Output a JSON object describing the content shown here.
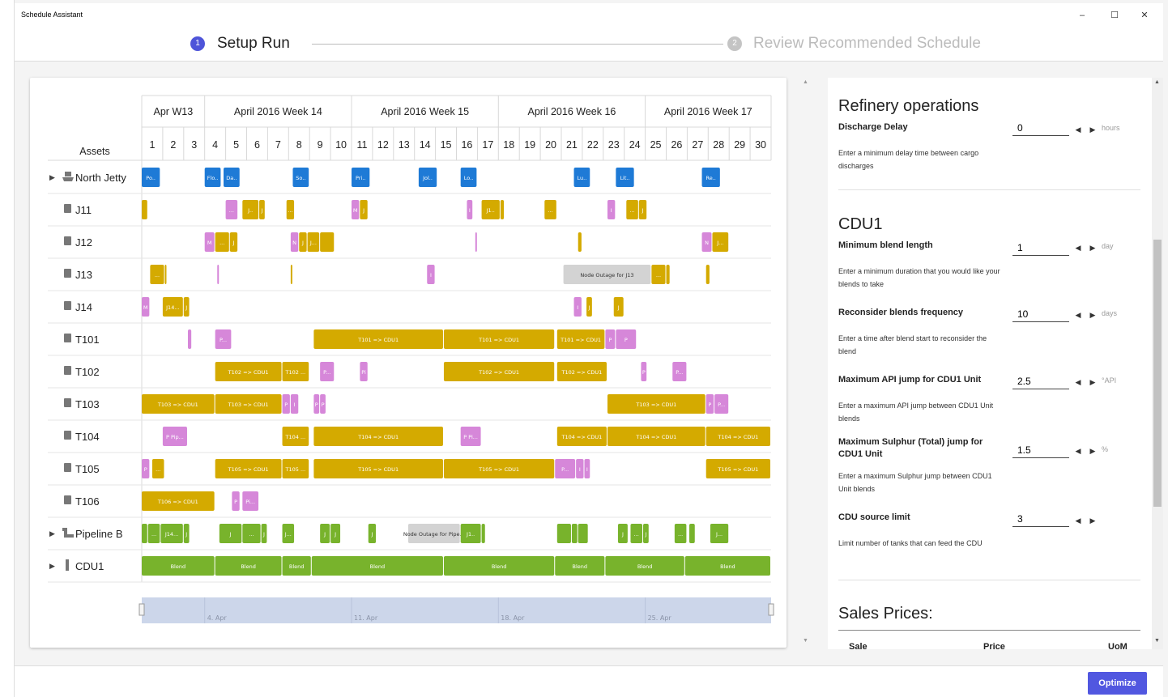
{
  "window": {
    "title": "Schedule Assistant",
    "minimize": "–",
    "maximize": "☐",
    "close": "✕"
  },
  "stepper": {
    "steps": [
      {
        "num": "1",
        "label": "Setup Run",
        "active": true
      },
      {
        "num": "2",
        "label": "Review Recommended Schedule",
        "active": false
      }
    ]
  },
  "gantt": {
    "assets_header": "Assets",
    "weeks": [
      {
        "label": "Apr W13",
        "start": 1,
        "end": 3
      },
      {
        "label": "April 2016 Week 14",
        "start": 4,
        "end": 10
      },
      {
        "label": "April 2016 Week 15",
        "start": 11,
        "end": 17
      },
      {
        "label": "April 2016 Week 16",
        "start": 18,
        "end": 24
      },
      {
        "label": "April 2016 Week 17",
        "start": 25,
        "end": 30
      }
    ],
    "days": [
      "1",
      "2",
      "3",
      "4",
      "5",
      "6",
      "7",
      "8",
      "9",
      "10",
      "11",
      "12",
      "13",
      "14",
      "15",
      "16",
      "17",
      "18",
      "19",
      "20",
      "21",
      "22",
      "23",
      "24",
      "25",
      "26",
      "27",
      "28",
      "29",
      "30"
    ],
    "rows": [
      {
        "label": "North Jetty",
        "icon": "ship-icon",
        "expand": true
      },
      {
        "label": "J11",
        "icon": "tank-icon"
      },
      {
        "label": "J12",
        "icon": "tank-icon"
      },
      {
        "label": "J13",
        "icon": "tank-icon"
      },
      {
        "label": "J14",
        "icon": "tank-icon"
      },
      {
        "label": "T101",
        "icon": "tank-icon"
      },
      {
        "label": "T102",
        "icon": "tank-icon"
      },
      {
        "label": "T103",
        "icon": "tank-icon"
      },
      {
        "label": "T104",
        "icon": "tank-icon"
      },
      {
        "label": "T105",
        "icon": "tank-icon"
      },
      {
        "label": "T106",
        "icon": "tank-icon"
      },
      {
        "label": "Pipeline B",
        "icon": "pipeline-icon",
        "expand": true
      },
      {
        "label": "CDU1",
        "icon": "cdu-icon",
        "expand": true
      }
    ],
    "bars": [
      [
        0,
        1,
        1.9,
        "b",
        "Po.."
      ],
      [
        0,
        4,
        4.8,
        "b",
        "Flo.."
      ],
      [
        0,
        4.9,
        5.7,
        "b",
        "Da.."
      ],
      [
        0,
        8.2,
        9,
        "b",
        "So.."
      ],
      [
        0,
        11,
        11.9,
        "b",
        "Pri.."
      ],
      [
        0,
        14.2,
        15.1,
        "b",
        "Jol.."
      ],
      [
        0,
        16.2,
        17,
        "b",
        "Lo.."
      ],
      [
        0,
        21.6,
        22.4,
        "b",
        "Lu.."
      ],
      [
        0,
        23.6,
        24.5,
        "b",
        "Lit.."
      ],
      [
        0,
        27.7,
        28.6,
        "b",
        "Re.."
      ],
      [
        1,
        1,
        1.3,
        "y",
        ""
      ],
      [
        1,
        5,
        5.6,
        "p",
        "..."
      ],
      [
        1,
        5.8,
        6.6,
        "y",
        "J.."
      ],
      [
        1,
        6.6,
        6.9,
        "y",
        "J"
      ],
      [
        1,
        7.9,
        8.3,
        "y",
        "..."
      ],
      [
        1,
        11,
        11.4,
        "p",
        "M"
      ],
      [
        1,
        11.4,
        11.8,
        "y",
        "J"
      ],
      [
        1,
        16.5,
        16.8,
        "p",
        "I"
      ],
      [
        1,
        17.2,
        18.1,
        "y",
        "J1.."
      ],
      [
        1,
        18.1,
        18.3,
        "y",
        "J"
      ],
      [
        1,
        20.2,
        20.8,
        "y",
        "..."
      ],
      [
        1,
        23.2,
        23.6,
        "p",
        "I"
      ],
      [
        1,
        24.1,
        24.7,
        "y",
        "..."
      ],
      [
        1,
        24.7,
        25.1,
        "y",
        "J"
      ],
      [
        2,
        4,
        4.5,
        "p",
        "M"
      ],
      [
        2,
        4.5,
        5.2,
        "y",
        "..."
      ],
      [
        2,
        5.2,
        5.6,
        "y",
        "J"
      ],
      [
        2,
        8.1,
        8.5,
        "p",
        "N"
      ],
      [
        2,
        8.5,
        8.9,
        "y",
        "J"
      ],
      [
        2,
        8.9,
        9.5,
        "y",
        "J..."
      ],
      [
        2,
        9.5,
        10.2,
        "y",
        ""
      ],
      [
        2,
        16.9,
        17,
        "p",
        "N"
      ],
      [
        2,
        21.8,
        22,
        "y",
        ""
      ],
      [
        2,
        27.7,
        28.2,
        "p",
        "N"
      ],
      [
        2,
        28.2,
        29,
        "y",
        "J..."
      ],
      [
        3,
        1.4,
        2.1,
        "y",
        "..."
      ],
      [
        3,
        2.1,
        2.2,
        "y",
        "J"
      ],
      [
        3,
        4.6,
        4.62,
        "p",
        ""
      ],
      [
        3,
        8.1,
        8.16,
        "y",
        "J"
      ],
      [
        3,
        14.6,
        15,
        "p",
        "I"
      ],
      [
        3,
        21.1,
        25.3,
        "g",
        "Node Outage for J13"
      ],
      [
        3,
        25.3,
        26,
        "y",
        "..."
      ],
      [
        3,
        26,
        26.2,
        "y",
        "J"
      ],
      [
        3,
        27.9,
        28.1,
        "y",
        "J"
      ],
      [
        4,
        1,
        1.4,
        "p",
        "M"
      ],
      [
        4,
        2,
        3,
        "y",
        "J14..."
      ],
      [
        4,
        3,
        3.3,
        "y",
        "J"
      ],
      [
        4,
        21.6,
        22,
        "p",
        "I"
      ],
      [
        4,
        22.2,
        22.5,
        "y",
        "J"
      ],
      [
        4,
        23.5,
        24,
        "y",
        "J"
      ],
      [
        5,
        3.2,
        3.4,
        "p",
        "P"
      ],
      [
        5,
        4.5,
        5.3,
        "p",
        "P..."
      ],
      [
        5,
        9.2,
        15.4,
        "y",
        "T101 => CDU1"
      ],
      [
        5,
        15.4,
        20.7,
        "y",
        "T101 => CDU1"
      ],
      [
        5,
        20.8,
        23.1,
        "y",
        "T101 => CDU1"
      ],
      [
        5,
        23.1,
        23.6,
        "p",
        "P"
      ],
      [
        5,
        23.6,
        24.6,
        "p",
        "P"
      ],
      [
        6,
        4.5,
        7.7,
        "y",
        "T102 => CDU1"
      ],
      [
        6,
        7.7,
        9,
        "y",
        "T102 ..."
      ],
      [
        6,
        9.5,
        10.2,
        "p",
        "P..."
      ],
      [
        6,
        11.4,
        11.8,
        "p",
        "Pi"
      ],
      [
        6,
        15.4,
        20.7,
        "y",
        "T102 => CDU1"
      ],
      [
        6,
        20.8,
        23.2,
        "y",
        "T102 => CDU1"
      ],
      [
        6,
        24.8,
        25.1,
        "p",
        "P"
      ],
      [
        6,
        26.3,
        27,
        "p",
        "P..."
      ],
      [
        7,
        1,
        4.5,
        "y",
        "T103 => CDU1"
      ],
      [
        7,
        4.5,
        7.7,
        "y",
        "T103 => CDU1"
      ],
      [
        7,
        7.7,
        8.1,
        "p",
        "P"
      ],
      [
        7,
        8.1,
        8.5,
        "p",
        "I"
      ],
      [
        7,
        9.2,
        9.5,
        "p",
        "P"
      ],
      [
        7,
        9.5,
        9.8,
        "p",
        "P"
      ],
      [
        7,
        23.2,
        27.9,
        "y",
        "T103 => CDU1"
      ],
      [
        7,
        27.9,
        28.3,
        "p",
        "P"
      ],
      [
        7,
        28.3,
        29,
        "p",
        "P..."
      ],
      [
        8,
        2,
        3.2,
        "p",
        "P Pip..."
      ],
      [
        8,
        7.7,
        9,
        "y",
        "T104 ..."
      ],
      [
        8,
        9.2,
        15.4,
        "y",
        "T104 => CDU1"
      ],
      [
        8,
        16.2,
        17.2,
        "p",
        "P Pi..."
      ],
      [
        8,
        20.8,
        23.2,
        "y",
        "T104 => CDU1"
      ],
      [
        8,
        23.2,
        27.9,
        "y",
        "T104 => CDU1"
      ],
      [
        8,
        27.9,
        31,
        "y",
        "T104 => CDU1"
      ],
      [
        9,
        1,
        1.4,
        "p",
        "P"
      ],
      [
        9,
        1.5,
        2.1,
        "y",
        "..."
      ],
      [
        9,
        4.5,
        7.7,
        "y",
        "T105 => CDU1"
      ],
      [
        9,
        7.7,
        9,
        "y",
        "T105 ..."
      ],
      [
        9,
        9.2,
        15.4,
        "y",
        "T105 => CDU1"
      ],
      [
        9,
        15.4,
        20.7,
        "y",
        "T105 => CDU1"
      ],
      [
        9,
        20.7,
        21.7,
        "p",
        "P..."
      ],
      [
        9,
        21.7,
        22.1,
        "p",
        "I"
      ],
      [
        9,
        22.1,
        22.4,
        "p",
        "I"
      ],
      [
        9,
        27.9,
        31,
        "y",
        "T105 => CDU1"
      ],
      [
        10,
        1,
        4.5,
        "y",
        "T106 => CDU1"
      ],
      [
        10,
        5.3,
        5.7,
        "p",
        "P"
      ],
      [
        10,
        5.8,
        6.6,
        "p",
        "Pi..."
      ],
      [
        11,
        1,
        1.3,
        "gr",
        ""
      ],
      [
        11,
        1.3,
        1.9,
        "gr",
        "..."
      ],
      [
        11,
        1.9,
        3,
        "gr",
        "J14..."
      ],
      [
        11,
        3,
        3.3,
        "gr",
        "J"
      ],
      [
        11,
        4.7,
        5.8,
        "gr",
        "J"
      ],
      [
        11,
        5.8,
        6.7,
        "gr",
        "..."
      ],
      [
        11,
        6.7,
        7,
        "gr",
        "J"
      ],
      [
        11,
        7.7,
        8.3,
        "gr",
        "J..."
      ],
      [
        11,
        9.5,
        10,
        "gr",
        "J"
      ],
      [
        11,
        10,
        10.5,
        "gr",
        "J"
      ],
      [
        11,
        11.8,
        12.2,
        "gr",
        "J"
      ],
      [
        11,
        13.7,
        16.2,
        "g",
        "Node Outage for Pipe..."
      ],
      [
        11,
        16.2,
        17.2,
        "gr",
        "J1.."
      ],
      [
        11,
        17.2,
        17.4,
        "gr",
        "J"
      ],
      [
        11,
        20.8,
        21.5,
        "gr",
        ""
      ],
      [
        11,
        21.5,
        21.8,
        "gr",
        ""
      ],
      [
        11,
        21.8,
        22.3,
        "gr",
        ""
      ],
      [
        11,
        23.7,
        24.2,
        "gr",
        "J"
      ],
      [
        11,
        24.3,
        24.9,
        "gr",
        "..."
      ],
      [
        11,
        24.9,
        25.2,
        "gr",
        "J"
      ],
      [
        11,
        26.4,
        27,
        "gr",
        "..."
      ],
      [
        11,
        27.1,
        27.4,
        "gr",
        ""
      ],
      [
        11,
        28.1,
        29,
        "gr",
        "J..."
      ],
      [
        12,
        1,
        4.5,
        "gr",
        "Blend"
      ],
      [
        12,
        4.5,
        7.7,
        "gr",
        "Blend"
      ],
      [
        12,
        7.7,
        9.1,
        "gr",
        "Blend"
      ],
      [
        12,
        9.1,
        15.4,
        "gr",
        "Blend"
      ],
      [
        12,
        15.4,
        20.7,
        "gr",
        "Blend"
      ],
      [
        12,
        20.7,
        23.1,
        "gr",
        "Blend"
      ],
      [
        12,
        23.1,
        26.9,
        "gr",
        "Blend"
      ],
      [
        12,
        26.9,
        31,
        "gr",
        "Blend"
      ]
    ],
    "navigator_labels": [
      "4. Apr",
      "11. Apr",
      "18. Apr",
      "25. Apr"
    ],
    "navigator_label_days": [
      4,
      11,
      18,
      25
    ],
    "colors": {
      "b": "#1e7ad6",
      "y": "#d4aa00",
      "p": "#d687d9",
      "g": "#d3d3d3",
      "gr": "#78b32c"
    }
  },
  "refinery": {
    "title": "Refinery operations",
    "discharge_label": "Discharge Delay",
    "discharge_value": "0",
    "discharge_unit": "hours",
    "discharge_desc": "Enter a minimum delay time between cargo discharges"
  },
  "cdu1": {
    "title": "CDU1",
    "fields": [
      {
        "label": "Minimum blend length",
        "value": "1",
        "unit": "day",
        "desc": "Enter a minimum duration that you would like your blends to take"
      },
      {
        "label": "Reconsider blends frequency",
        "value": "10",
        "unit": "days",
        "desc": "Enter a time after blend start to reconsider the blend"
      },
      {
        "label": "Maximum API jump for CDU1 Unit",
        "value": "2.5",
        "unit": "°API",
        "desc": "Enter a maximum API jump between CDU1 Unit blends"
      },
      {
        "label": "Maximum Sulphur (Total) jump for CDU1 Unit",
        "value": "1.5",
        "unit": "%",
        "desc": "Enter a maximum Sulphur jump between CDU1 Unit blends"
      },
      {
        "label": "CDU source limit",
        "value": "3",
        "unit": "",
        "desc": "Limit number of tanks that can feed the CDU"
      }
    ]
  },
  "sales": {
    "title": "Sales Prices:",
    "columns": [
      "Sale",
      "Price",
      "UoM"
    ]
  },
  "footer": {
    "optimize_label": "Optimize"
  }
}
